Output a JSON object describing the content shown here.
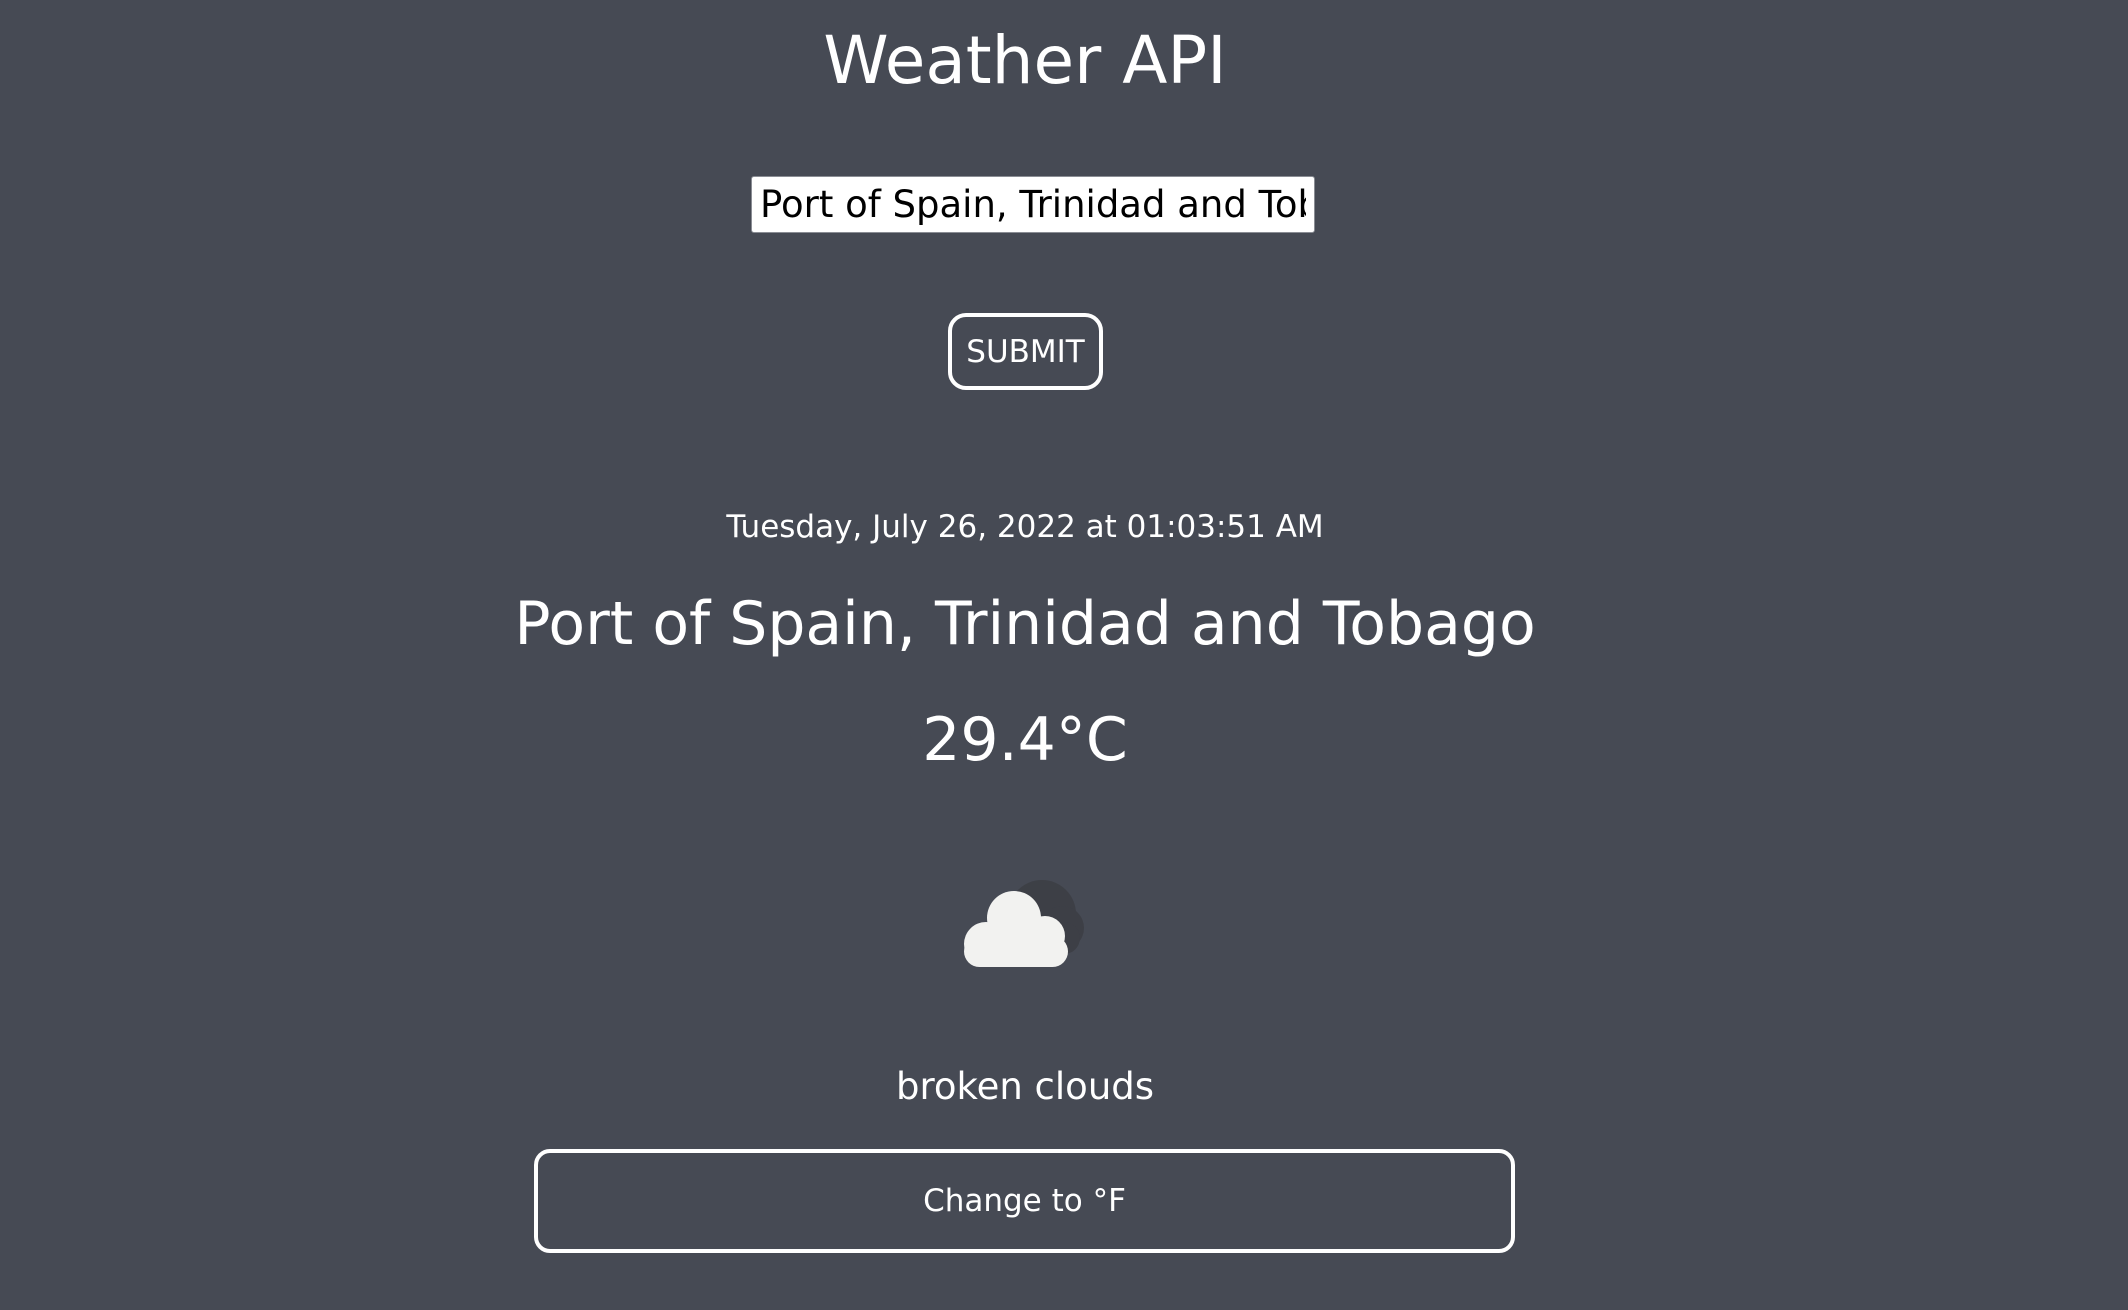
{
  "app": {
    "title": "Weather API"
  },
  "search": {
    "value": "Port of Spain, Trinidad and Tobago"
  },
  "submit": {
    "label": "SUBMIT"
  },
  "weather": {
    "timestamp": "Tuesday, July 26, 2022 at 01:03:51 AM",
    "location": "Port of Spain, Trinidad and Tobago",
    "temperature": "29.4°C",
    "icon": "broken-clouds-icon",
    "description": "broken clouds"
  },
  "unit_toggle": {
    "label": "Change to °F"
  },
  "colors": {
    "background": "#464a54",
    "text": "#ffffff",
    "cloud": "#f2f2f0",
    "cloud_shadow": "#3c3e44"
  }
}
